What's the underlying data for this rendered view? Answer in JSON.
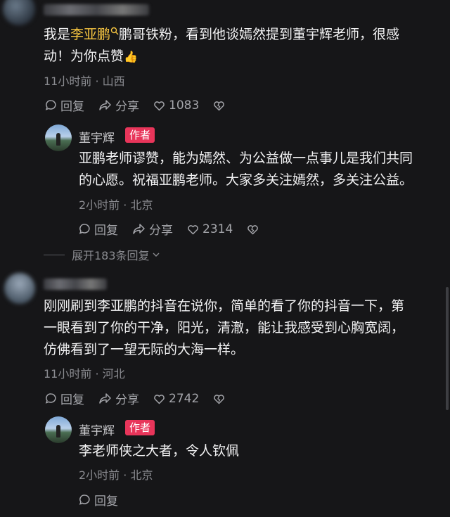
{
  "comments": [
    {
      "text_pre": "我是",
      "highlight": "李亚鹏",
      "text_line1_post": "鹏哥铁粉，看到他谈嫣然提到董宇辉老师，很感",
      "text_line2": "动！为你点赞",
      "emoji": "👍",
      "meta": "11小时前 · 山西",
      "reply_label": "回复",
      "share_label": "分享",
      "likes": "1083",
      "reply": {
        "name": "董宇辉",
        "badge": "作者",
        "line1": "亚鹏老师谬赞，能为嫣然、为公益做一点事儿是我们共同",
        "line2": "的心愿。祝福亚鹏老师。大家多关注嫣然，多关注公益。",
        "meta": "2小时前 · 北京",
        "reply_label": "回复",
        "share_label": "分享",
        "likes": "2314"
      },
      "expand_label": "展开183条回复"
    },
    {
      "line1": "刚刚刷到李亚鹏的抖音在说你，简单的看了你的抖音一下，第",
      "line2": "一眼看到了你的干净，阳光，清澈，能让我感受到心胸宽阔，",
      "line3": "仿佛看到了一望无际的大海一样。",
      "meta": "11小时前 · 河北",
      "reply_label": "回复",
      "share_label": "分享",
      "likes": "2742",
      "reply": {
        "name": "董宇辉",
        "badge": "作者",
        "line1": "李老师侠之大者，令人钦佩",
        "meta": "2小时前 · 北京",
        "reply_label": "回复"
      }
    }
  ],
  "colors": {
    "highlight": "#f5c441",
    "badge": "#e8355a",
    "background": "#161618"
  }
}
